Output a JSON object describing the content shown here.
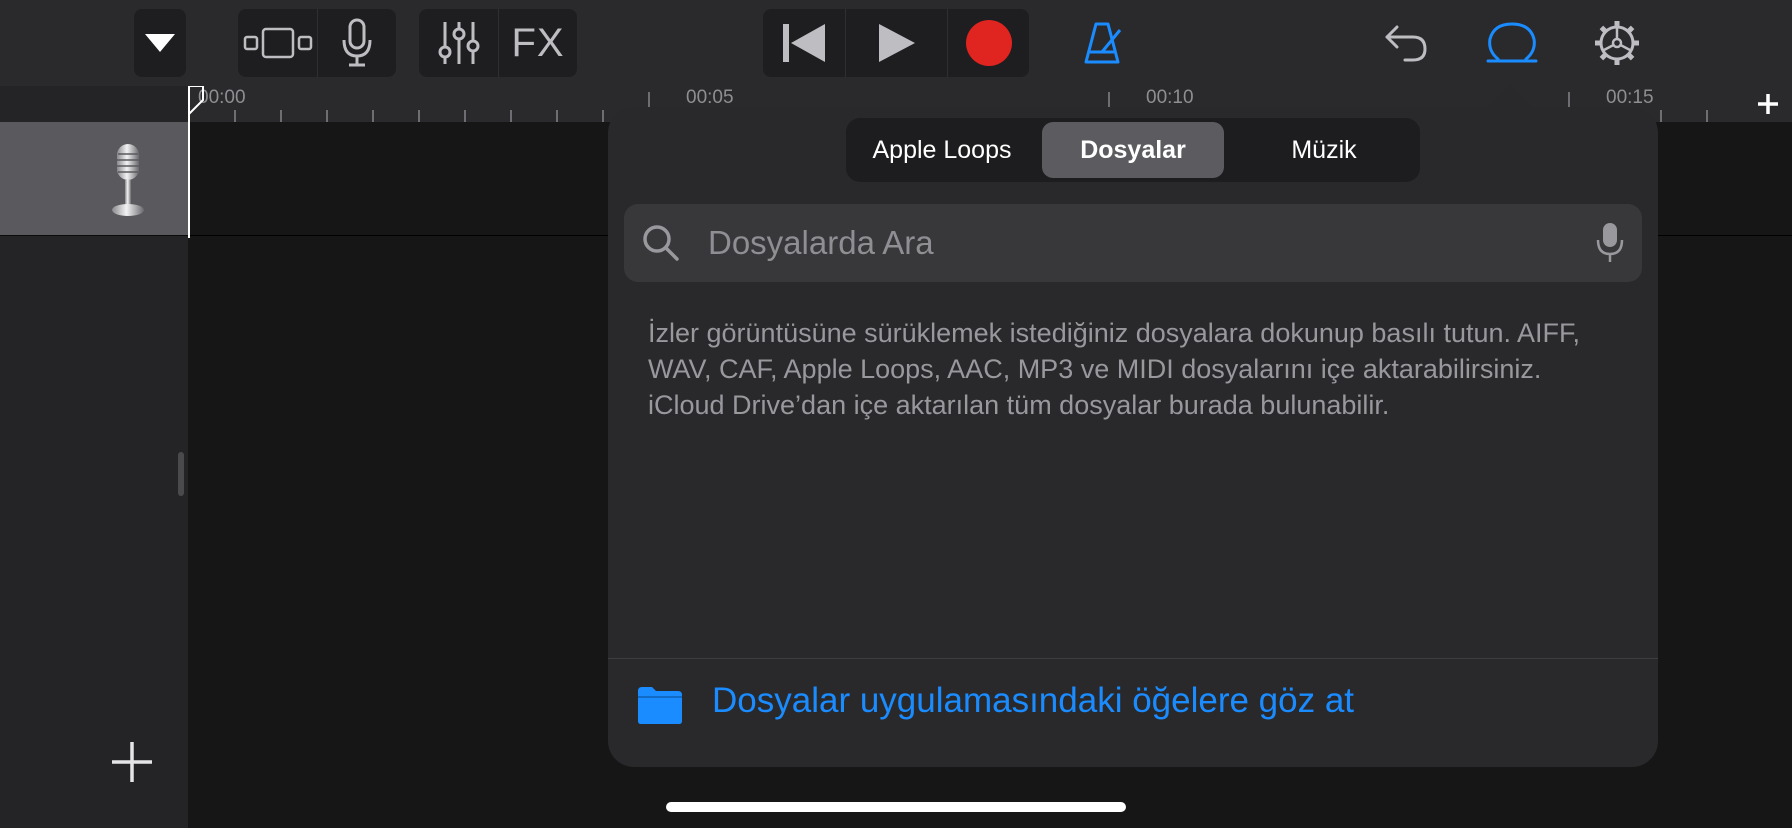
{
  "toolbar": {
    "fx_label": "FX",
    "colors": {
      "icon": "#bdbdc2",
      "accent": "#1a8cff",
      "record": "#e0241f"
    },
    "icons": [
      "dropdown-triangle-icon",
      "track-view-icon",
      "microphone-icon",
      "mixer-icon",
      "fx",
      "rewind-icon",
      "play-icon",
      "record-icon",
      "metronome-icon",
      "undo-icon",
      "loop-browser-icon",
      "settings-icon"
    ]
  },
  "ruler": {
    "labels": [
      "00:00",
      "00:05",
      "00:10",
      "00:15"
    ],
    "add_label": "+"
  },
  "popover": {
    "tabs": [
      {
        "label": "Apple Loops",
        "selected": false
      },
      {
        "label": "Dosyalar",
        "selected": true
      },
      {
        "label": "Müzik",
        "selected": false
      }
    ],
    "search": {
      "placeholder": "Dosyalarda Ara",
      "value": ""
    },
    "help_text": "İzler görüntüsüne sürüklemek istediğiniz dosyalara dokunup basılı tutun. AIFF, WAV, CAF, Apple Loops, AAC, MP3 ve MIDI dosyalarını içe aktarabilirsiniz. iCloud Drive’dan içe aktarılan tüm dosyalar burada bulunabilir.",
    "browse_label": "Dosyalar uygulamasındaki öğelere göz at"
  }
}
